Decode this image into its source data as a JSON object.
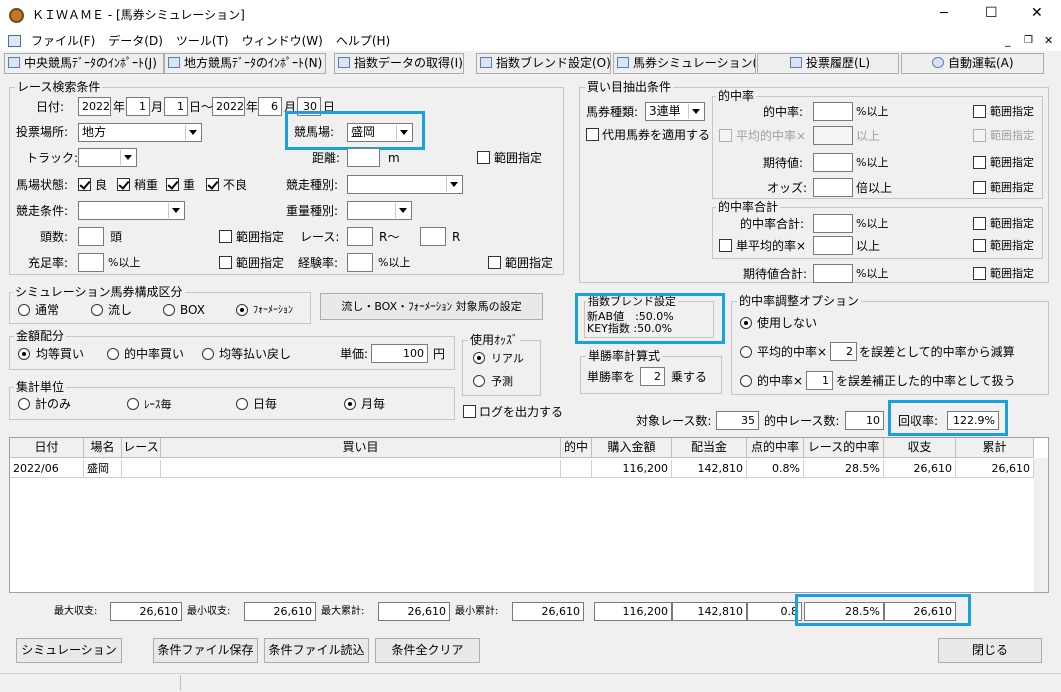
{
  "window": {
    "title": "ＫＩＷＡＭＥ - [馬券シミュレーション]",
    "minimize": "─",
    "maximize": "☐",
    "close": "✕"
  },
  "menu": {
    "file": "ファイル(F)",
    "data": "データ(D)",
    "tool": "ツール(T)",
    "window": "ウィンドウ(W)",
    "help": "ヘルプ(H)"
  },
  "tabs": [
    "中央競馬ﾃﾞｰﾀのｲﾝﾎﾟｰﾄ(J)",
    "地方競馬ﾃﾞｰﾀのｲﾝﾎﾟｰﾄ(N)",
    "指数データの取得(I)",
    "指数ブレンド設定(O)",
    "馬券シミュレーション(B)",
    "投票履歴(L)",
    "自動運転(A)"
  ],
  "race": {
    "group": "レース検索条件",
    "date_label": "日付:",
    "y1": "2022",
    "y_unit": "年",
    "m1": "1",
    "m_unit": "月",
    "d1": "1",
    "d_unit": "日～",
    "y2": "2022",
    "y_unit2": "年",
    "m2": "6",
    "m_unit2": "月",
    "d2": "30",
    "d_unit2": "日",
    "place_label": "投票場所:",
    "place": "地方",
    "venue_label": "競馬場:",
    "venue": "盛岡",
    "track_label": "トラック:",
    "distance_label": "距離:",
    "distance_unit": "m",
    "range": "範囲指定",
    "baba_label": "馬場状態:",
    "baba": [
      "良",
      "稍重",
      "重",
      "不良"
    ],
    "kind_label": "競走種別:",
    "cond_label": "競走条件:",
    "weight_label": "重量種別:",
    "heads_label": "頭数:",
    "heads_unit": "頭",
    "race_label": "レース:",
    "race_from": "R～",
    "race_to": "R",
    "fill_label": "充足率:",
    "pct_up": "%以上",
    "exp_label": "経験率:"
  },
  "sim": {
    "group": "シミュレーション馬券構成区分",
    "options": [
      "通常",
      "流し",
      "BOX",
      "ﾌｫｰﾒｰｼｮﾝ"
    ],
    "set_button": "流し・BOX・ﾌｫｰﾒｰｼｮﾝ 対象馬の設定"
  },
  "money": {
    "group": "金額配分",
    "options": [
      "均等買い",
      "的中率買い",
      "均等払い戻し"
    ],
    "unit_label": "単価:",
    "unit_value": "100",
    "yen": "円"
  },
  "odds": {
    "group": "使用ｵｯｽﾞ",
    "options": [
      "リアル",
      "予測"
    ]
  },
  "agg": {
    "group": "集計単位",
    "options": [
      "計のみ",
      "ﾚｰｽ毎",
      "日毎",
      "月毎"
    ],
    "log": "ログを出力する"
  },
  "buy": {
    "group": "買い目抽出条件",
    "kind_label": "馬券種類:",
    "kind": "3連単",
    "substitute": "代用馬券を適用する",
    "hit_group": "的中率",
    "hit": "的中率:",
    "pct_up": "%以上",
    "avg_hit": "平均的中率",
    "up": "以上",
    "range": "範囲指定",
    "expect": "期待値:",
    "odds": "オッズ:",
    "times_up": "倍以上",
    "sum_group": "的中率合計",
    "hit_sum": "的中率合計:",
    "single_avg": "単平均的率",
    "expect_sum": "期待値合計:"
  },
  "blend": {
    "title": "指数ブレンド設定",
    "line1": "新AB値　:50.0%",
    "line2": "KEY指数 :50.0%"
  },
  "tansho": {
    "group": "単勝率計算式",
    "prefix": "単勝率を",
    "value": "2",
    "suffix": "乗する"
  },
  "adjust": {
    "group": "的中率調整オプション",
    "opt1": "使用しない",
    "opt2a": "平均的中率×",
    "opt2v": "2",
    "opt2b": "を誤差として的中率から減算",
    "opt3a": "的中率×",
    "opt3v": "1",
    "opt3b": "を誤差補正した的中率として扱う"
  },
  "summary": {
    "target_label": "対象レース数:",
    "target": "35",
    "hit_label": "的中レース数:",
    "hit": "10",
    "return_label": "回収率:",
    "return": "122.9%"
  },
  "table": {
    "headers": [
      "日付",
      "場名",
      "レース",
      "買い目",
      "的中",
      "購入金額",
      "配当金",
      "点的中率",
      "レース的中率",
      "収支",
      "累計"
    ],
    "rows": [
      [
        "2022/06",
        "盛岡",
        "",
        "",
        "",
        "116,200",
        "142,810",
        "0.8%",
        "28.5%",
        "26,610",
        "26,610"
      ]
    ]
  },
  "footer": {
    "max_income_label": "最大収支:",
    "max_income": "26,610",
    "min_income_label": "最小収支:",
    "min_income": "26,610",
    "max_cum_label": "最大累計:",
    "max_cum": "26,610",
    "min_cum_label": "最小累計:",
    "min_cum": "26,610",
    "buy": "116,200",
    "payout": "142,810",
    "point": "0.8",
    "race_rate": "28.5%",
    "total": "26,610"
  },
  "buttons": {
    "simulate": "シミュレーション",
    "save": "条件ファイル保存",
    "load": "条件ファイル読込",
    "clear": "条件全クリア",
    "close": "閉じる"
  }
}
